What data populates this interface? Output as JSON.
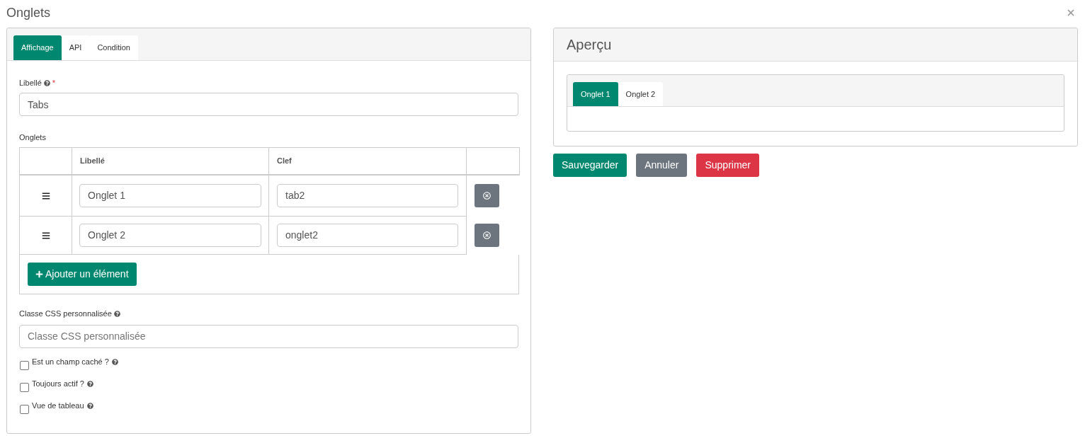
{
  "dialog": {
    "title": "Onglets"
  },
  "editor": {
    "tabs": [
      {
        "label": "Affichage",
        "selected": true
      },
      {
        "label": "API",
        "selected": false
      },
      {
        "label": "Condition",
        "selected": false
      }
    ],
    "label_field": {
      "label": "Libellé",
      "required_mark": "*",
      "value": "Tabs"
    },
    "tabs_list": {
      "label": "Onglets",
      "columns": [
        "Libellé",
        "Clef"
      ],
      "rows": [
        {
          "label": "Onglet 1",
          "key": "tab2"
        },
        {
          "label": "Onglet 2",
          "key": "onglet2"
        }
      ],
      "add_button": "Ajouter un élément"
    },
    "css_class_field": {
      "label": "Classe CSS personnalisée",
      "placeholder": "Classe CSS personnalisée"
    },
    "options": [
      {
        "label": "Est un champ caché ?",
        "checked": false
      },
      {
        "label": "Toujours actif ?",
        "checked": false
      },
      {
        "label": "Vue de tableau",
        "checked": false
      }
    ]
  },
  "preview": {
    "title": "Aperçu",
    "tabs": [
      {
        "label": "Onglet 1",
        "selected": true
      },
      {
        "label": "Onglet 2",
        "selected": false
      }
    ]
  },
  "actions": [
    {
      "label": "Sauvegarder",
      "kind": "primary"
    },
    {
      "label": "Annuler",
      "kind": "secondary"
    },
    {
      "label": "Supprimer",
      "kind": "danger"
    }
  ]
}
